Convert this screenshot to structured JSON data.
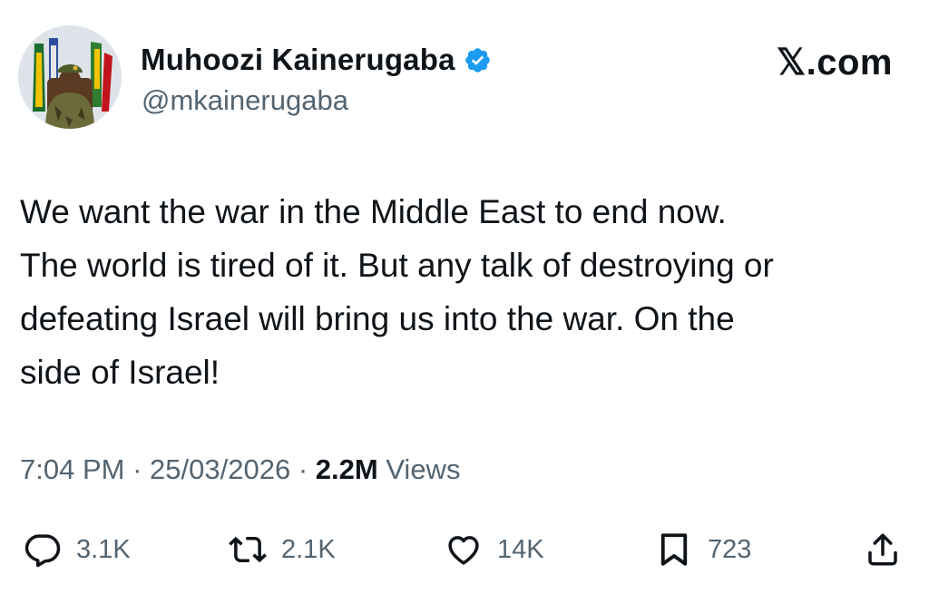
{
  "author": {
    "display_name": "Muhoozi Kainerugaba",
    "handle": "@mkainerugaba",
    "verified_icon": "verified-badge-icon",
    "avatar": "profile-photo"
  },
  "brand": {
    "label": "𝕏.com"
  },
  "tweet": {
    "text": "We want the war in the Middle East to end now.\nThe world is tired of it. But any talk of destroying or\ndefeating Israel will bring us into the war. On the\nside of Israel!"
  },
  "meta": {
    "time": "7:04 PM",
    "separator": "·",
    "date": "25/03/2026",
    "views_count": "2.2M",
    "views_label": "Views"
  },
  "actions": {
    "replies": {
      "icon": "reply-icon",
      "count": "3.1K"
    },
    "reposts": {
      "icon": "repost-icon",
      "count": "2.1K"
    },
    "likes": {
      "icon": "heart-icon",
      "count": "14K"
    },
    "bookmarks": {
      "icon": "bookmark-icon",
      "count": "723"
    },
    "share": {
      "icon": "share-icon"
    }
  },
  "colors": {
    "text": "#0f1419",
    "muted": "#536471",
    "verified": "#1d9bf0",
    "background": "#ffffff"
  }
}
